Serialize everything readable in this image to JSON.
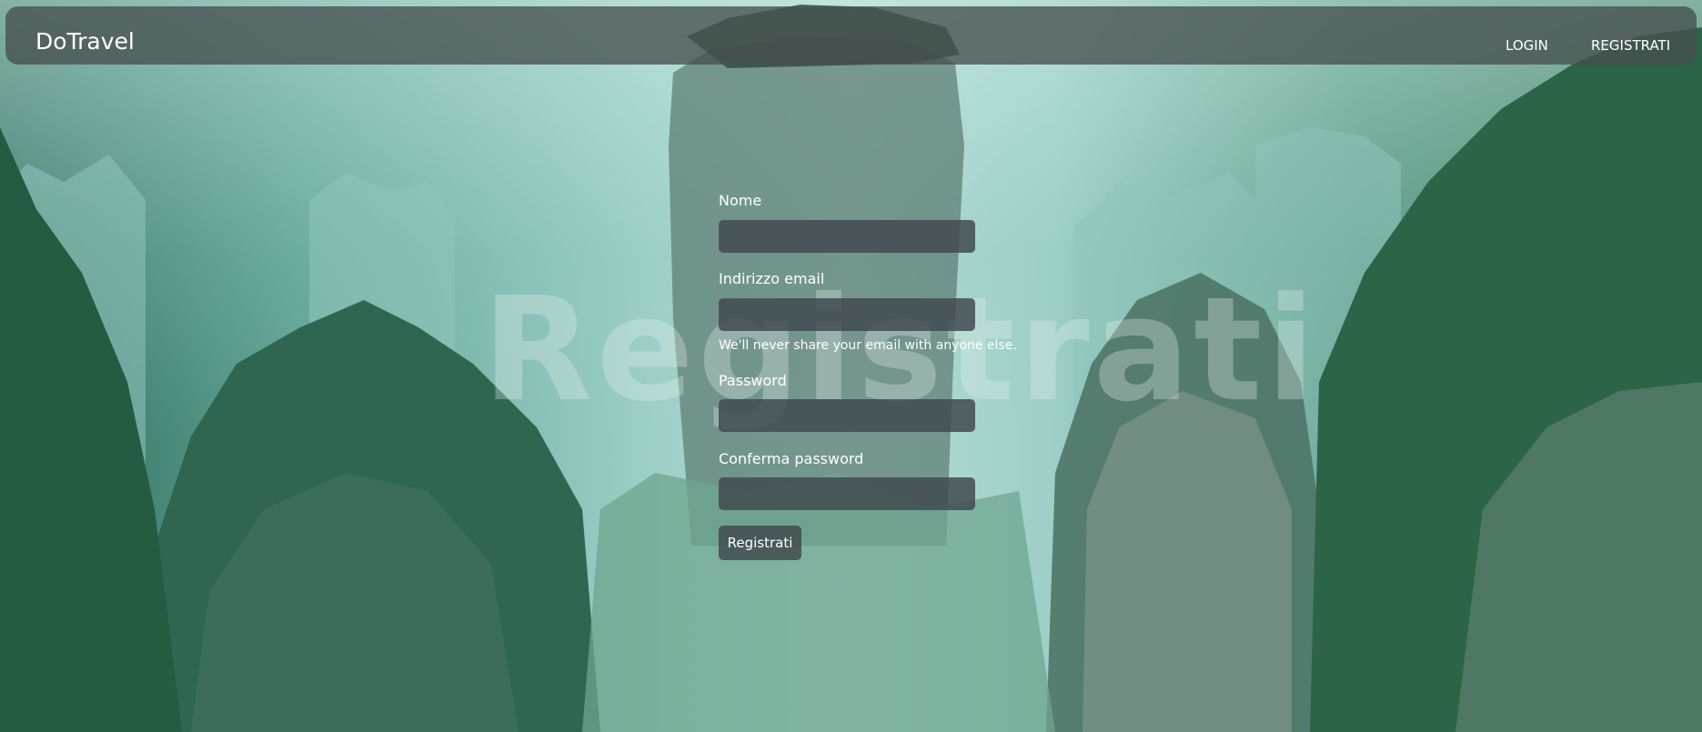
{
  "navbar": {
    "brand": "DoTravel",
    "login_label": "LOGIN",
    "register_label": "REGISTRATI"
  },
  "page": {
    "watermark": "Registrati"
  },
  "form": {
    "name_label": "Nome",
    "name_value": "",
    "email_label": "Indirizzo email",
    "email_value": "",
    "email_help": "We'll never share your email with anyone else.",
    "password_label": "Password",
    "password_value": "",
    "confirm_label": "Conferma password",
    "confirm_value": "",
    "submit_label": "Registrati"
  },
  "colors": {
    "navbar_bg": "#46504e",
    "input_bg": "#414b50",
    "text": "#ffffff"
  }
}
